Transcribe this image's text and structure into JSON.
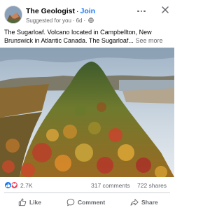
{
  "post": {
    "page_name": "The Geologist",
    "separator": "·",
    "join_label": "Join",
    "suggested_label": "Suggested for you",
    "time_ago": "6d",
    "caption": "The Sugarloaf. Volcano located in Campbellton, New Brunswick in Atlantic Canada. The Sugarloaf...",
    "see_more_label": "See more",
    "icons": {
      "avatar": "avatar-image",
      "audience": "globe-icon",
      "more": "more-options-icon",
      "close": "close-icon"
    }
  },
  "engagement": {
    "reaction_count": "2.7K",
    "comments": "317 comments",
    "shares": "722 shares",
    "reaction_icons": [
      "like-reaction-icon",
      "love-reaction-icon"
    ],
    "colors": {
      "like": "#1877f2",
      "love": "#f33e58"
    }
  },
  "actions": {
    "like_label": "Like",
    "comment_label": "Comment",
    "share_label": "Share"
  },
  "theme": {
    "link_color": "#1877f2",
    "muted_text": "#65676b",
    "primary_text": "#050505"
  }
}
